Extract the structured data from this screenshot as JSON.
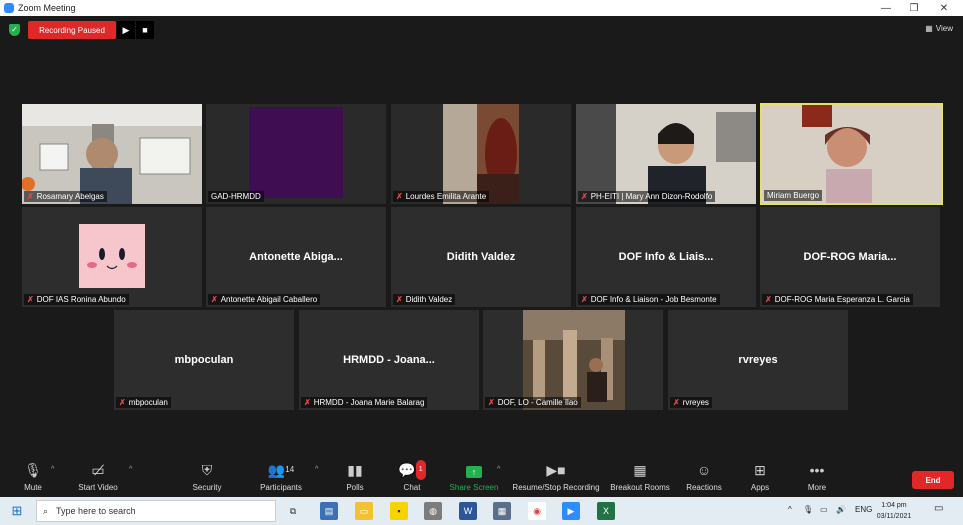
{
  "window": {
    "title": "Zoom Meeting",
    "controls": [
      "—",
      "❐",
      "✕"
    ]
  },
  "meeting_bar": {
    "recording_label": "Recording Paused",
    "view_label": "View"
  },
  "participants": [
    {
      "name": "Rosamary Abelgas",
      "display": "",
      "video": true,
      "muted": true,
      "active": false
    },
    {
      "name": "GAD-HRMDD",
      "display": "",
      "video": true,
      "muted": false,
      "active": false
    },
    {
      "name": "Lourdes Emilita Arante",
      "display": "",
      "video": true,
      "muted": true,
      "active": false
    },
    {
      "name": "PH-EITI | Mary Ann Dizon-Rodolfo",
      "display": "",
      "video": true,
      "muted": true,
      "active": false
    },
    {
      "name": "Miriam Buergo",
      "display": "",
      "video": true,
      "muted": false,
      "active": true
    },
    {
      "name": "DOF IAS Ronina Abundo",
      "display": "",
      "video": false,
      "muted": true,
      "active": false
    },
    {
      "name": "Antonette Abigail Caballero",
      "display": "Antonette  Abiga...",
      "video": false,
      "muted": true,
      "active": false
    },
    {
      "name": "Didith Valdez",
      "display": "Didith Valdez",
      "video": false,
      "muted": true,
      "active": false
    },
    {
      "name": "DOF Info & Liaison - Job Besmonte",
      "display": "DOF Info & Liais...",
      "video": false,
      "muted": true,
      "active": false
    },
    {
      "name": "DOF-ROG Maria Esperanza L. Garcia",
      "display": "DOF-ROG  Maria...",
      "video": false,
      "muted": true,
      "active": false
    },
    {
      "name": "mbpoculan",
      "display": "mbpoculan",
      "video": false,
      "muted": true,
      "active": false
    },
    {
      "name": "HRMDD - Joana Marie Balarag",
      "display": "HRMDD - Joana...",
      "video": false,
      "muted": true,
      "active": false
    },
    {
      "name": "DOF, LO - Camille Ilao",
      "display": "",
      "video": true,
      "muted": true,
      "active": false
    },
    {
      "name": "rvreyes",
      "display": "rvreyes",
      "video": false,
      "muted": true,
      "active": false
    }
  ],
  "toolbar": {
    "mute": "Mute",
    "start_video": "Start Video",
    "security": "Security",
    "participants": "Participants",
    "participants_count": "14",
    "polls": "Polls",
    "chat": "Chat",
    "chat_badge": "1",
    "share_screen": "Share Screen",
    "resume_stop_recording": "Resume/Stop Recording",
    "breakout_rooms": "Breakout Rooms",
    "reactions": "Reactions",
    "apps": "Apps",
    "more": "More",
    "end": "End"
  },
  "taskbar": {
    "search_placeholder": "Type here to search",
    "language": "ENG",
    "time": "1:04 pm",
    "date": "03/11/2021"
  },
  "colors": {
    "accent_red": "#e02828",
    "share_green": "#23b14d",
    "active_border": "#e6e06a"
  }
}
